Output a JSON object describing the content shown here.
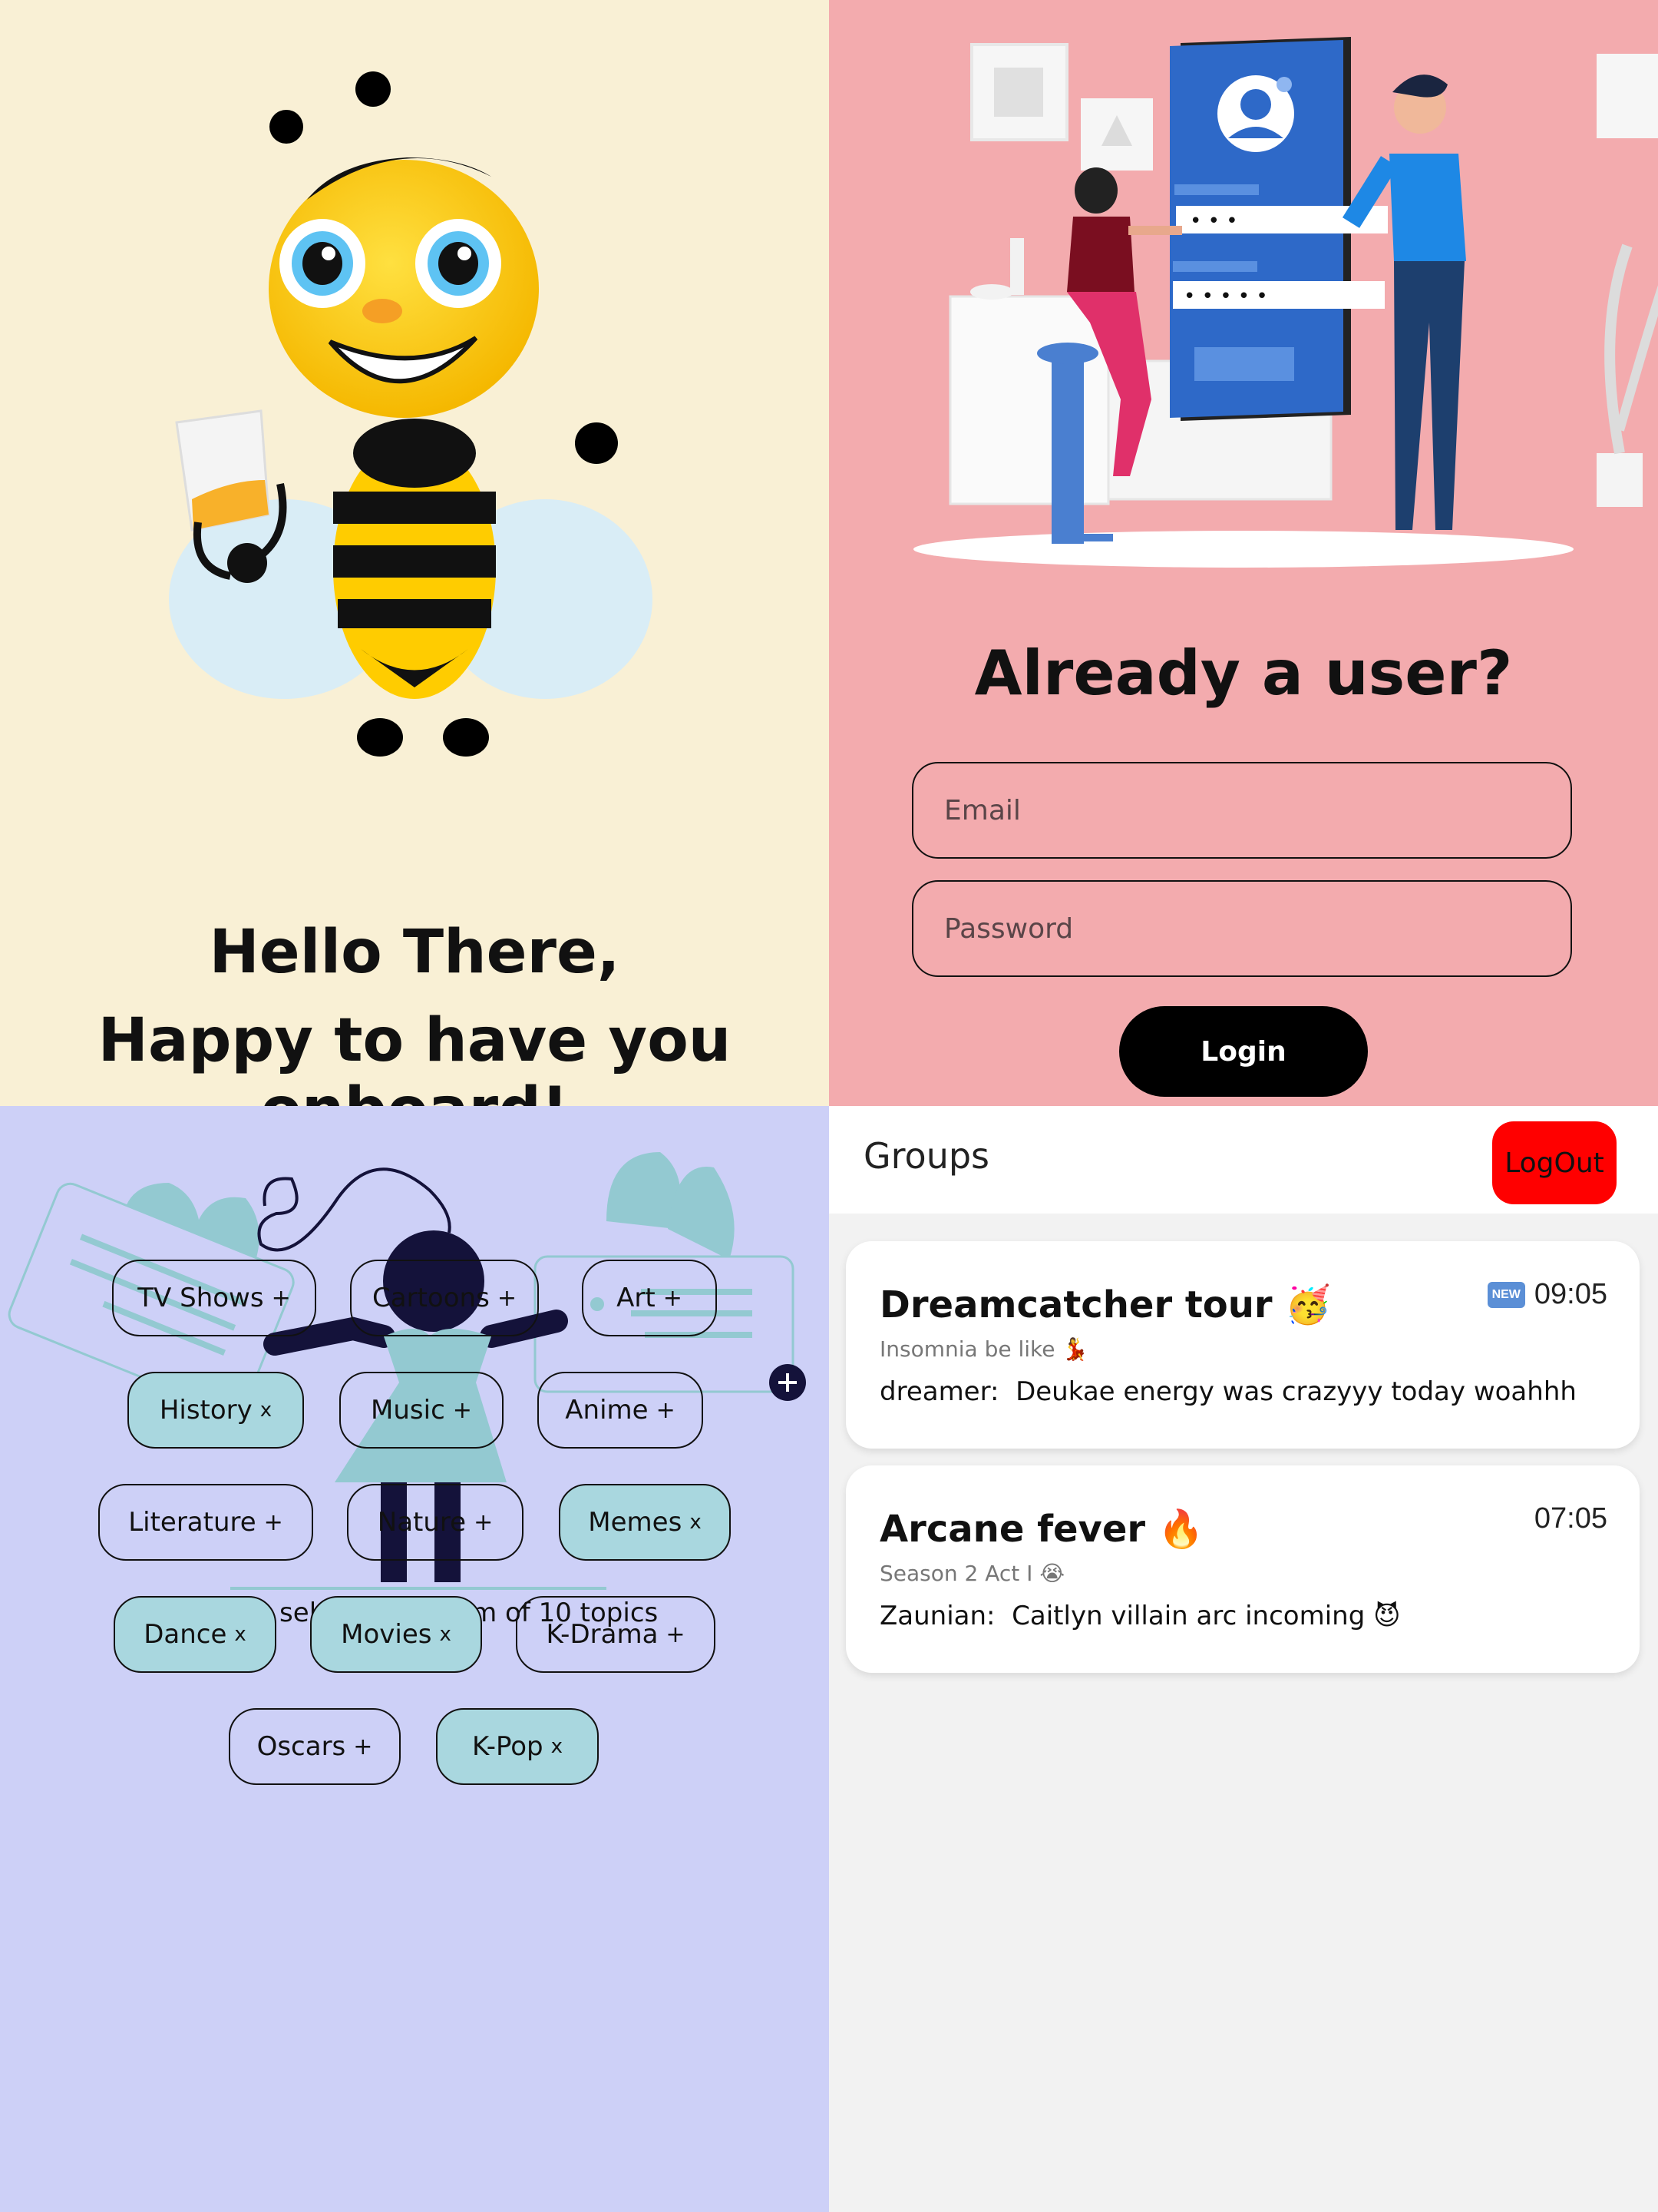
{
  "onboarding": {
    "greeting_line1": "Hello There,",
    "greeting_line2": "Happy to have you onboard!"
  },
  "login": {
    "title": "Already a user?",
    "email_placeholder": "Email",
    "password_placeholder": "Password",
    "login_label": "Login",
    "illustration_password_dots_1": "• • •",
    "illustration_password_dots_2": "• • • • •"
  },
  "topics": {
    "note": "You can select maximum of 10 topics",
    "items": [
      {
        "label": "TV Shows",
        "suffix": "+",
        "selected": false
      },
      {
        "label": "Cartoons",
        "suffix": "+",
        "selected": false
      },
      {
        "label": "Art",
        "suffix": "+",
        "selected": false
      },
      {
        "label": "History",
        "suffix": "x",
        "selected": true
      },
      {
        "label": "Music",
        "suffix": "+",
        "selected": false
      },
      {
        "label": "Anime",
        "suffix": "+",
        "selected": false
      },
      {
        "label": "Literature",
        "suffix": "+",
        "selected": false
      },
      {
        "label": "Nature",
        "suffix": "+",
        "selected": false
      },
      {
        "label": "Memes",
        "suffix": "x",
        "selected": true
      },
      {
        "label": "Dance",
        "suffix": "x",
        "selected": true
      },
      {
        "label": "Movies",
        "suffix": "x",
        "selected": true
      },
      {
        "label": "K-Drama",
        "suffix": "+",
        "selected": false
      },
      {
        "label": "Oscars",
        "suffix": "+",
        "selected": false
      },
      {
        "label": "K-Pop",
        "suffix": "x",
        "selected": true
      }
    ]
  },
  "groups": {
    "title": "Groups",
    "logout_label": "LogOut",
    "cards": [
      {
        "name": "Dreamcatcher tour 🥳",
        "subtitle": "Insomnia be like 💃",
        "badge": "NEW",
        "time": "09:05",
        "sender": "dreamer:",
        "message": "Deukae energy was crazyyy today woahhh"
      },
      {
        "name": "Arcane fever 🔥",
        "subtitle": "Season 2 Act I 😭",
        "badge": "",
        "time": "07:05",
        "sender": "Zaunian:",
        "message": "Caitlyn villain arc incoming 😈"
      }
    ]
  },
  "colors": {
    "onboarding_bg": "#f9f0d5",
    "login_bg": "#f3abae",
    "topics_bg": "#cdd0f7",
    "chip_selected": "#a9d7df",
    "groups_bg": "#f2f2f2",
    "logout_bg": "#ff0000",
    "login_button_bg": "#000000"
  }
}
